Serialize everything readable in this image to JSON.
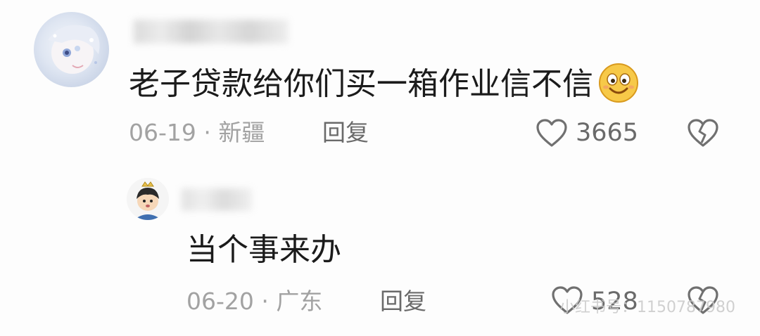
{
  "comments": [
    {
      "text": "老子贷款给你们买一箱作业信不信",
      "emoji": "smile-emoji",
      "date": "06-19",
      "separator": " · ",
      "location": "新疆",
      "reply_label": "回复",
      "likes": "3665"
    },
    {
      "text": "当个事来办",
      "date": "06-20",
      "separator": " · ",
      "location": "广东",
      "reply_label": "回复",
      "likes": "528"
    }
  ],
  "watermark": "小红书号：1150787980",
  "icons": {
    "like": "heart-outline-icon",
    "dislike": "broken-heart-icon"
  },
  "colors": {
    "text": "#1b1b1b",
    "meta": "#a2a2a2",
    "action": "#6a6a6a",
    "emoji_face": "#f7c948"
  }
}
